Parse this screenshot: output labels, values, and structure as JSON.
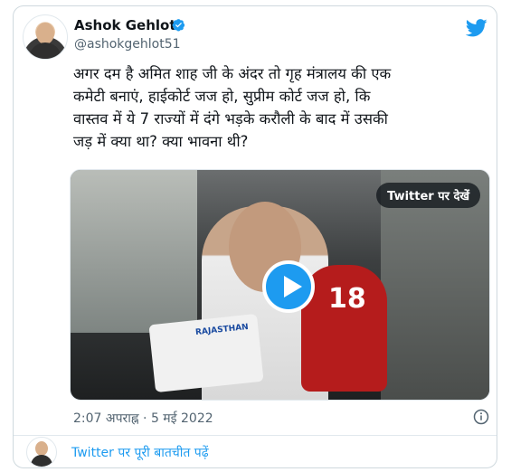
{
  "author": {
    "name": "Ashok Gehlot",
    "handle": "@ashokgehlot51",
    "verified": true
  },
  "tweet": {
    "text": "अगर दम है अमित शाह जी के अंदर तो गृह मंत्रालय की एक\nकमेटी बनाएं, हाईकोर्ट जज हो, सुप्रीम कोर्ट जज हो, कि\nवास्तव में ये 7 राज्यों में दंगे भड़के करौली के बाद में उसकी\nजड़ में क्या था? क्या भावना थी?",
    "timestamp": "2:07 अपराह्न · 5 मई 2022"
  },
  "media": {
    "watch_label": "Twitter पर देखें",
    "mic_number": "18",
    "mic_brand": "RAJASTHAN"
  },
  "footer": {
    "conversation_link": "Twitter पर पूरी बातचीत पढ़ें"
  },
  "icons": {
    "brand": "twitter-bird-icon",
    "verified": "verified-badge-icon",
    "play": "play-icon",
    "info": "info-icon"
  },
  "colors": {
    "accent": "#1d9bf0",
    "text": "#0f1419",
    "muted": "#536471",
    "border": "#cfd9de"
  }
}
